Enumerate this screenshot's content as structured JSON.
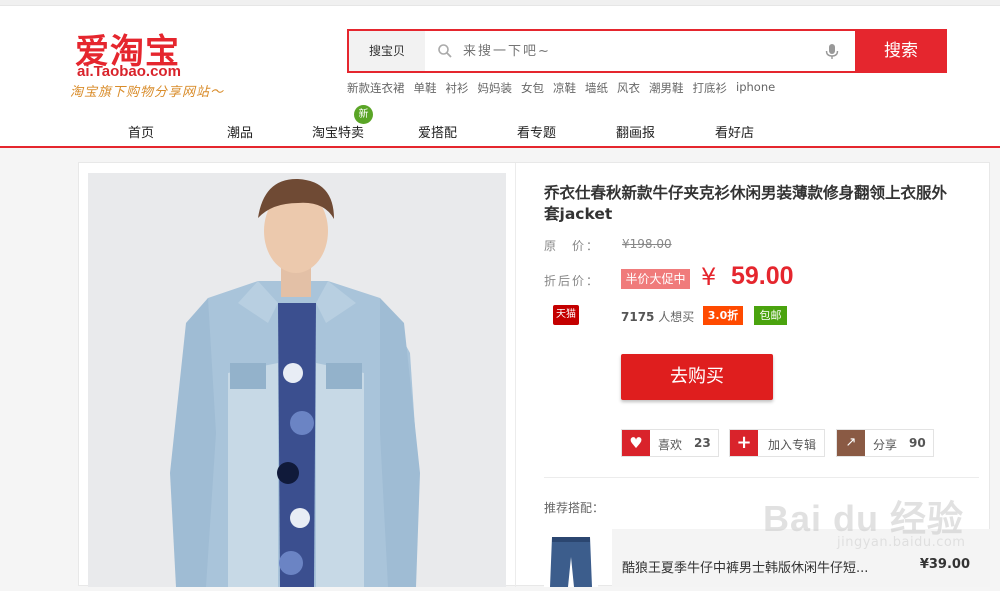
{
  "header": {
    "logo_cn": "爱淘宝",
    "logo_en": "ai.Taobao.com",
    "slogan": "淘宝旗下购物分享网站～"
  },
  "search": {
    "category": "搜宝贝",
    "placeholder": "来搜一下吧~",
    "button_label": "搜索",
    "hot_words": [
      "新款连衣裙",
      "单鞋",
      "衬衫",
      "妈妈装",
      "女包",
      "凉鞋",
      "墙纸",
      "风衣",
      "潮男鞋",
      "打底衫",
      "iphone"
    ]
  },
  "nav": {
    "items": [
      "首页",
      "潮品",
      "淘宝特卖",
      "爱搭配",
      "看专题",
      "翻画报",
      "看好店"
    ],
    "new_badge": "新"
  },
  "product": {
    "title": "乔衣仕春秋新款牛仔夹克衫休闲男装薄款修身翻领上衣服外套jacket",
    "orig_label": "原　价：",
    "orig_price": "¥198.00",
    "sale_label": "折后价：",
    "promo_badge": "半价大促中",
    "currency": "¥",
    "price": "59.00",
    "shop_badge": "天猫",
    "want_count": "7175",
    "want_suffix": "人想买",
    "discount": "3.0折",
    "shipping": "包邮",
    "buy_label": "去购买"
  },
  "actions": {
    "like_label": "喜欢",
    "like_count": "23",
    "add_label": "加入专辑",
    "share_label": "分享",
    "share_count": "90"
  },
  "recommend": {
    "label": "推荐搭配：",
    "item_name": "酷狼王夏季牛仔中裤男士韩版休闲牛仔短...",
    "item_price": "¥39.00"
  },
  "watermark": {
    "text": "Bai du 经验",
    "sub": "jingyan.baidu.com"
  },
  "colors": {
    "brand_red": "#e5262e",
    "promo_pink": "#f07b7b",
    "discount_orange": "#ff4a00",
    "shipping_green": "#4aa30e",
    "like_red": "#d9232b",
    "share_brown": "#8a5a44"
  }
}
